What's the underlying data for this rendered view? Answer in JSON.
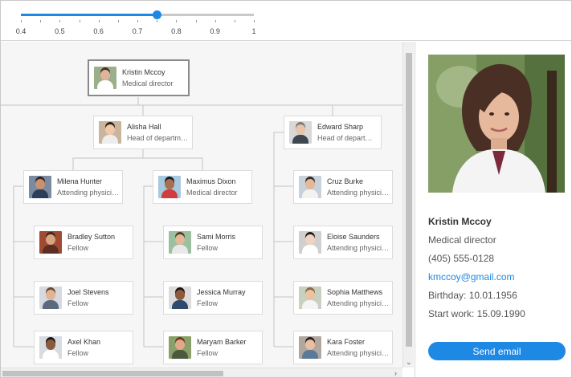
{
  "zoom": {
    "min": 0.4,
    "max": 1,
    "value": 0.75,
    "tick_labels": [
      "0.4",
      "0.5",
      "0.6",
      "0.7",
      "0.8",
      "0.9",
      "1"
    ]
  },
  "colors": {
    "accent": "#1e88e5"
  },
  "employees": {
    "kristin": {
      "name": "Kristin Mccoy",
      "title": "Medical director",
      "bg": "#9bb08a",
      "skin": "#e0b39a",
      "hair": "#4a3024",
      "shirt": "#ffffff"
    },
    "alisha": {
      "name": "Alisha Hall",
      "title": "Head of department",
      "bg": "#c9b49e",
      "skin": "#f0c8a8",
      "hair": "#2d2018",
      "shirt": "#ededed"
    },
    "edward": {
      "name": "Edward Sharp",
      "title": "Head of department",
      "bg": "#d8d8d8",
      "skin": "#e8c4a8",
      "hair": "#7a7a7a",
      "shirt": "#3e4650"
    },
    "milena": {
      "name": "Milena Hunter",
      "title": "Attending physician",
      "bg": "#7a8aa0",
      "skin": "#c99072",
      "hair": "#3a2418",
      "shirt": "#2c3e5a"
    },
    "maximus": {
      "name": "Maximus Dixon",
      "title": "Medical director",
      "bg": "#a8c8e0",
      "skin": "#a8704e",
      "hair": "#1a1a1a",
      "shirt": "#d23c3c"
    },
    "cruz": {
      "name": "Cruz Burke",
      "title": "Attending physician",
      "bg": "#c8d2dc",
      "skin": "#e6b89a",
      "hair": "#3a2c22",
      "shirt": "#f2f2f2"
    },
    "bradley": {
      "name": "Bradley Sutton",
      "title": "Fellow",
      "bg": "#a04a32",
      "skin": "#d8a482",
      "hair": "#3a2a1e",
      "shirt": "#5a2e22"
    },
    "sami": {
      "name": "Sami Morris",
      "title": "Fellow",
      "bg": "#9ac0a0",
      "skin": "#e2b896",
      "hair": "#5a3a28",
      "shirt": "#e8e8e8"
    },
    "eloise": {
      "name": "Eloise Saunders",
      "title": "Attending physician",
      "bg": "#d0d0d0",
      "skin": "#f0d4c0",
      "hair": "#1c1c1c",
      "shirt": "#ffffff"
    },
    "joel": {
      "name": "Joel Stevens",
      "title": "Fellow",
      "bg": "#d6dae0",
      "skin": "#e2b496",
      "hair": "#6a4a30",
      "shirt": "#5a6a7c"
    },
    "jessica": {
      "name": "Jessica Murray",
      "title": "Fellow",
      "bg": "#dcdcdc",
      "skin": "#8c5a3c",
      "hair": "#1e1410",
      "shirt": "#2e4a6e"
    },
    "sophia": {
      "name": "Sophia Matthews",
      "title": "Attending physician",
      "bg": "#c8d0c0",
      "skin": "#eac2a4",
      "hair": "#8a6a44",
      "shirt": "#f4f4f4"
    },
    "axel": {
      "name": "Axel Khan",
      "title": "Fellow",
      "bg": "#d8dce0",
      "skin": "#8a5a3e",
      "hair": "#1a1412",
      "shirt": "#ffffff"
    },
    "maryam": {
      "name": "Maryam Barker",
      "title": "Fellow",
      "bg": "#8aa06a",
      "skin": "#e0aa8a",
      "hair": "#6a3a22",
      "shirt": "#4a5a3a"
    },
    "kara": {
      "name": "Kara Foster",
      "title": "Attending physician",
      "bg": "#b0a8a0",
      "skin": "#e8c0a0",
      "hair": "#2a1e16",
      "shirt": "#5a7a9a"
    }
  },
  "details": {
    "name": "Kristin Mccoy",
    "title": "Medical director",
    "phone": "(405) 555-0128",
    "email": "kmccoy@gmail.com",
    "birthday": "Birthday: 10.01.1956",
    "start_work": "Start work: 15.09.1990",
    "button_label": "Send email"
  },
  "scroll": {
    "right_arrow": "›",
    "down_arrow": "⌄"
  }
}
